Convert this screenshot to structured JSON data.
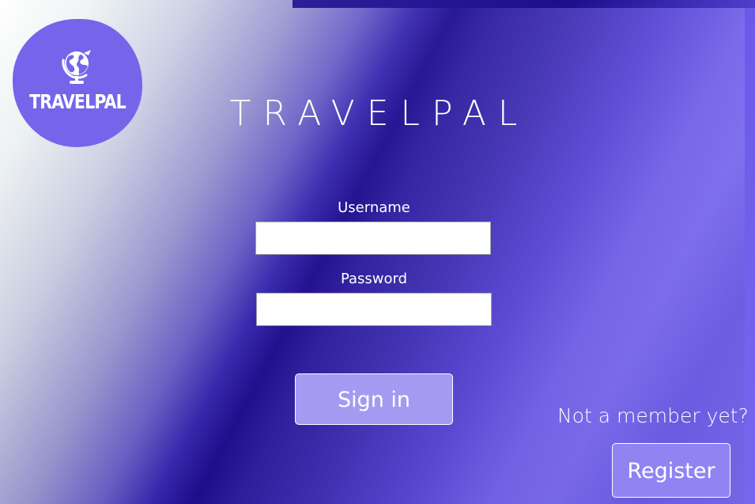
{
  "window": {
    "background_colors": [
      "#ffffff",
      "#1f0d8f",
      "#7c6cf0"
    ]
  },
  "logo": {
    "icon": "globe-icon",
    "text": "TRAVELPAL",
    "color": "#7665ea"
  },
  "app_title": "TRAVELPAL",
  "login_form": {
    "username_label": "Username",
    "username_value": "",
    "password_label": "Password",
    "password_value": "",
    "sign_in_label": "Sign in"
  },
  "register_prompt": {
    "text": "Not a member yet?",
    "register_label": "Register"
  },
  "colors": {
    "accent": "#7665ea",
    "button_fill": "#a49af2",
    "register_fill": "#9183f2"
  }
}
